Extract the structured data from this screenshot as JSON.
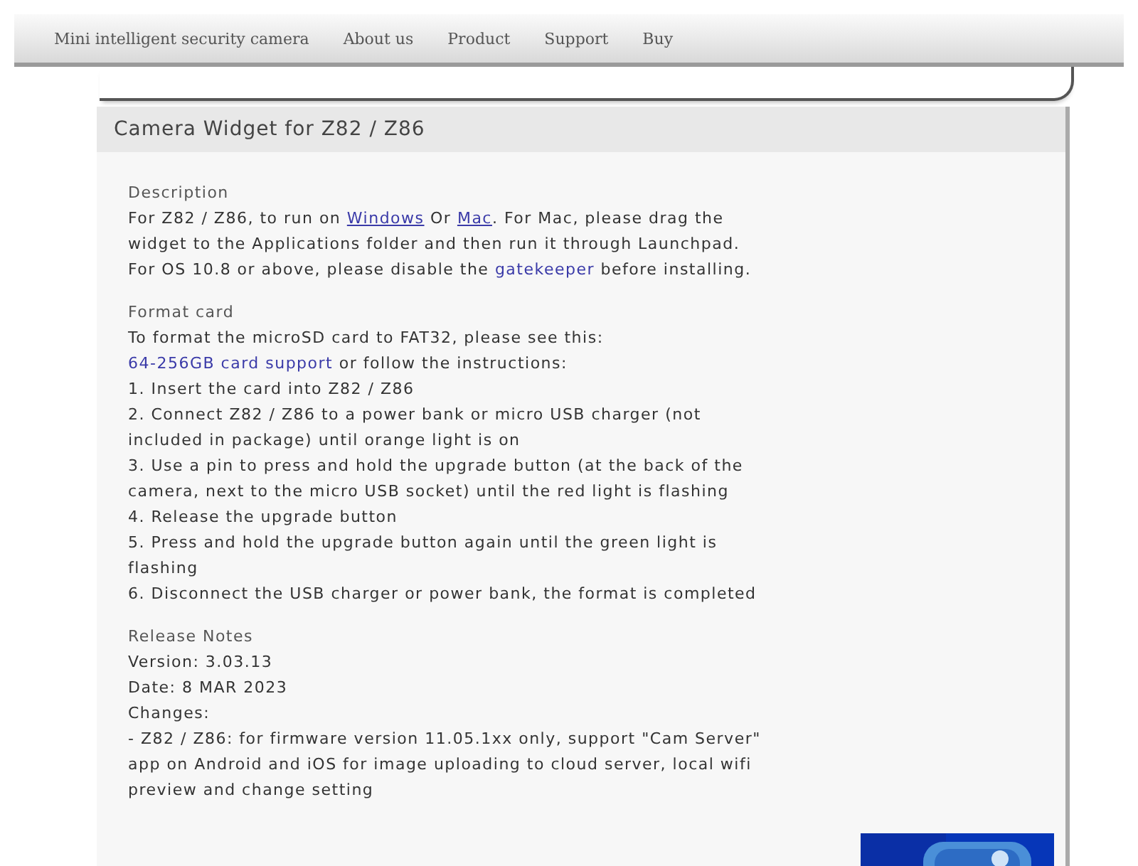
{
  "nav": {
    "items": [
      {
        "label": "Mini intelligent security camera"
      },
      {
        "label": "About us"
      },
      {
        "label": "Product"
      },
      {
        "label": "Support"
      },
      {
        "label": "Buy"
      }
    ]
  },
  "panel": {
    "title": "Camera Widget for Z82 / Z86",
    "sections": [
      {
        "heading": "Description",
        "paragraphs": [
          [
            {
              "kind": "text",
              "text": "For Z82 / Z86, to run on "
            },
            {
              "kind": "link",
              "text": "Windows",
              "underlined": true
            },
            {
              "kind": "text",
              "text": " Or "
            },
            {
              "kind": "link",
              "text": "Mac",
              "underlined": true
            },
            {
              "kind": "text",
              "text": ". For Mac, please drag the widget to the Applications folder and then run it through Launchpad. For OS 10.8 or above, please disable the "
            },
            {
              "kind": "link",
              "text": "gatekeeper",
              "underlined": false
            },
            {
              "kind": "text",
              "text": " before installing."
            }
          ]
        ]
      },
      {
        "heading": "Format card",
        "paragraphs": [
          [
            {
              "kind": "text",
              "text": "To format the microSD card to FAT32, please see this: "
            },
            {
              "kind": "link",
              "text": "64-256GB card support",
              "underlined": false
            },
            {
              "kind": "text",
              "text": " or follow the instructions:"
            }
          ],
          [
            {
              "kind": "text",
              "text": "1. Insert the card into Z82 / Z86"
            }
          ],
          [
            {
              "kind": "text",
              "text": "2. Connect Z82 / Z86 to a power bank or micro USB charger (not included in package) until orange light is on"
            }
          ],
          [
            {
              "kind": "text",
              "text": "3. Use a pin to press and hold the upgrade button (at the back of the camera, next to the micro USB socket) until the red light is flashing"
            }
          ],
          [
            {
              "kind": "text",
              "text": "4. Release the upgrade button"
            }
          ],
          [
            {
              "kind": "text",
              "text": "5. Press and hold the upgrade button again until the green light is flashing"
            }
          ],
          [
            {
              "kind": "text",
              "text": "6. Disconnect the USB charger or power bank, the format is completed"
            }
          ]
        ]
      },
      {
        "heading": "Release Notes",
        "paragraphs": [
          [
            {
              "kind": "text",
              "text": "Version: 3.03.13"
            }
          ],
          [
            {
              "kind": "text",
              "text": "Date: 8 MAR 2023"
            }
          ],
          [
            {
              "kind": "text",
              "text": "Changes:"
            }
          ],
          [
            {
              "kind": "text",
              "text": "- Z82 / Z86: for firmware version 11.05.1xx only, support \"Cam Server\" app on Android and iOS for image uploading to cloud server, local wifi preview and change setting"
            }
          ]
        ]
      }
    ]
  }
}
